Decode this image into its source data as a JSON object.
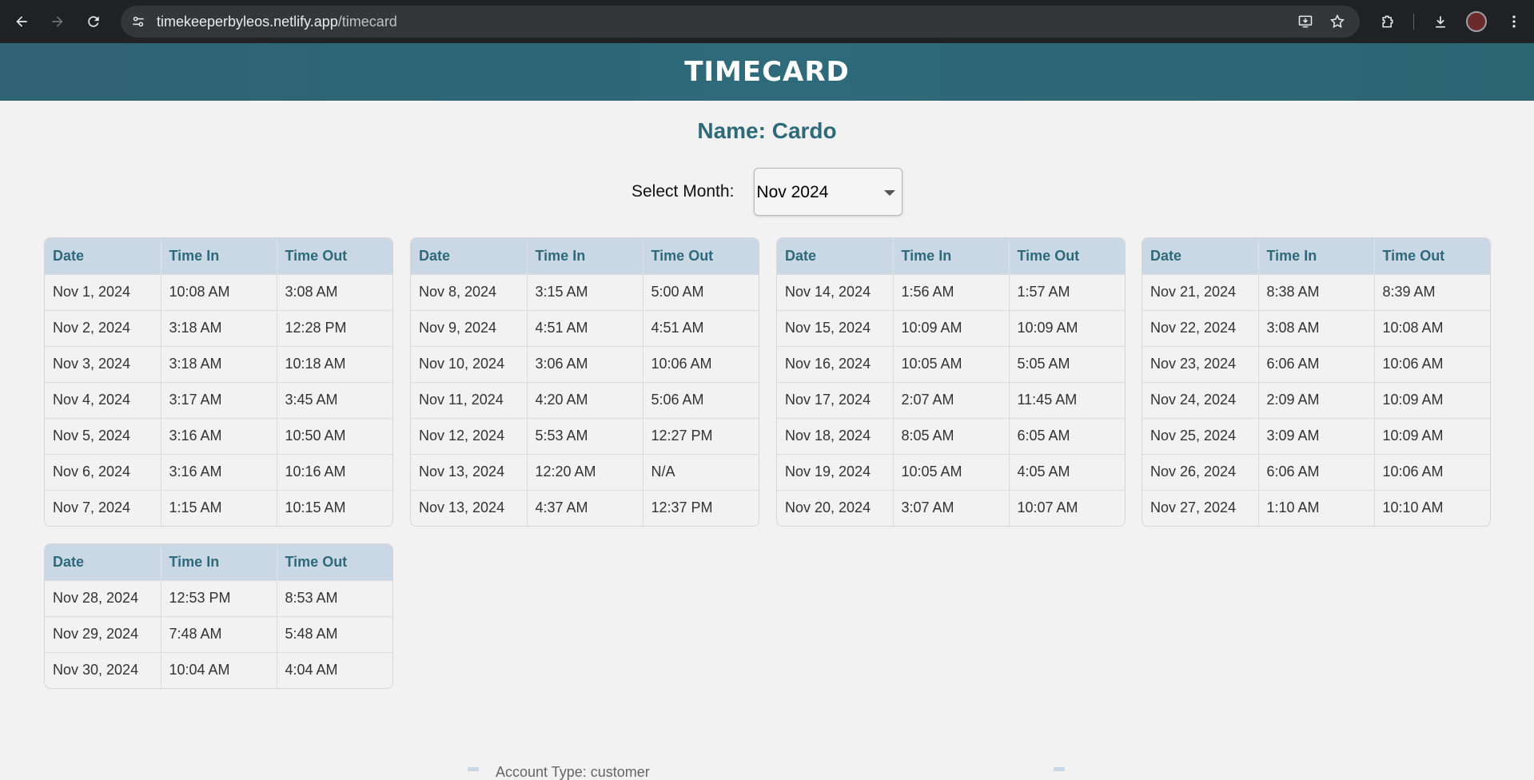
{
  "browser": {
    "url_host": "timekeeperbyleos.netlify.app",
    "url_path": "/timecard"
  },
  "header": {
    "title": "TIMECARD"
  },
  "name_line": "Name: Cardo",
  "month": {
    "label": "Select Month:",
    "selected": "Nov 2024"
  },
  "columns": [
    "Date",
    "Time In",
    "Time Out"
  ],
  "tables": [
    {
      "rows": [
        [
          "Nov 1, 2024",
          "10:08 AM",
          "3:08 AM"
        ],
        [
          "Nov 2, 2024",
          "3:18 AM",
          "12:28 PM"
        ],
        [
          "Nov 3, 2024",
          "3:18 AM",
          "10:18 AM"
        ],
        [
          "Nov 4, 2024",
          "3:17 AM",
          "3:45 AM"
        ],
        [
          "Nov 5, 2024",
          "3:16 AM",
          "10:50 AM"
        ],
        [
          "Nov 6, 2024",
          "3:16 AM",
          "10:16 AM"
        ],
        [
          "Nov 7, 2024",
          "1:15 AM",
          "10:15 AM"
        ]
      ]
    },
    {
      "rows": [
        [
          "Nov 8, 2024",
          "3:15 AM",
          "5:00 AM"
        ],
        [
          "Nov 9, 2024",
          "4:51 AM",
          "4:51 AM"
        ],
        [
          "Nov 10, 2024",
          "3:06 AM",
          "10:06 AM"
        ],
        [
          "Nov 11, 2024",
          "4:20 AM",
          "5:06 AM"
        ],
        [
          "Nov 12, 2024",
          "5:53 AM",
          "12:27 PM"
        ],
        [
          "Nov 13, 2024",
          "12:20 AM",
          "N/A"
        ],
        [
          "Nov 13, 2024",
          "4:37 AM",
          "12:37 PM"
        ]
      ]
    },
    {
      "rows": [
        [
          "Nov 14, 2024",
          "1:56 AM",
          "1:57 AM"
        ],
        [
          "Nov 15, 2024",
          "10:09 AM",
          "10:09 AM"
        ],
        [
          "Nov 16, 2024",
          "10:05 AM",
          "5:05 AM"
        ],
        [
          "Nov 17, 2024",
          "2:07 AM",
          "11:45 AM"
        ],
        [
          "Nov 18, 2024",
          "8:05 AM",
          "6:05 AM"
        ],
        [
          "Nov 19, 2024",
          "10:05 AM",
          "4:05 AM"
        ],
        [
          "Nov 20, 2024",
          "3:07 AM",
          "10:07 AM"
        ]
      ]
    },
    {
      "rows": [
        [
          "Nov 21, 2024",
          "8:38 AM",
          "8:39 AM"
        ],
        [
          "Nov 22, 2024",
          "3:08 AM",
          "10:08 AM"
        ],
        [
          "Nov 23, 2024",
          "6:06 AM",
          "10:06 AM"
        ],
        [
          "Nov 24, 2024",
          "2:09 AM",
          "10:09 AM"
        ],
        [
          "Nov 25, 2024",
          "3:09 AM",
          "10:09 AM"
        ],
        [
          "Nov 26, 2024",
          "6:06 AM",
          "10:06 AM"
        ],
        [
          "Nov 27, 2024",
          "1:10 AM",
          "10:10 AM"
        ]
      ]
    },
    {
      "rows": [
        [
          "Nov 28, 2024",
          "12:53 PM",
          "8:53 AM"
        ],
        [
          "Nov 29, 2024",
          "7:48 AM",
          "5:48 AM"
        ],
        [
          "Nov 30, 2024",
          "10:04 AM",
          "4:04 AM"
        ]
      ]
    }
  ],
  "footer_peek": "Account Type: customer"
}
